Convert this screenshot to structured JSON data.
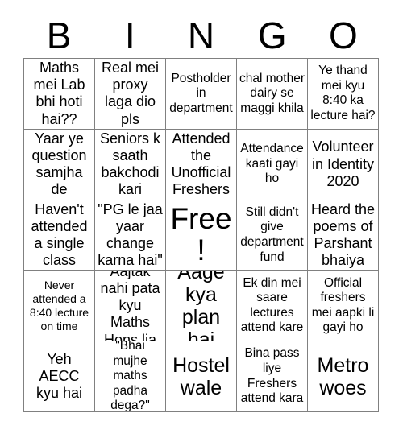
{
  "card": {
    "title_letters": [
      "B",
      "I",
      "N",
      "G",
      "O"
    ],
    "rows": [
      [
        {
          "text": "Maths mei Lab bhi hoti hai??",
          "size": "md"
        },
        {
          "text": "Real mei proxy laga dio pls",
          "size": "md"
        },
        {
          "text": "Postholder in department",
          "size": "sm"
        },
        {
          "text": "chal mother dairy se maggi khila",
          "size": "sm"
        },
        {
          "text": "Ye thand mei kyu 8:40 ka lecture hai?",
          "size": "sm"
        }
      ],
      [
        {
          "text": "Yaar ye question samjha de",
          "size": "md"
        },
        {
          "text": "Seniors k saath bakchodi kari",
          "size": "md"
        },
        {
          "text": "Attended the Unofficial Freshers",
          "size": "md"
        },
        {
          "text": "Attendance kaati gayi ho",
          "size": "sm"
        },
        {
          "text": "Volunteer in Identity 2020",
          "size": "md"
        }
      ],
      [
        {
          "text": "Haven't attended a single class",
          "size": "md"
        },
        {
          "text": "\"PG le jaa yaar change karna hai\"",
          "size": "md"
        },
        {
          "text": "Free!",
          "size": "xl"
        },
        {
          "text": "Still didn't give department fund",
          "size": "sm"
        },
        {
          "text": "Heard the poems of Parshant bhaiya",
          "size": "md"
        }
      ],
      [
        {
          "text": "Never attended a 8:40 lecture on time",
          "size": "xs"
        },
        {
          "text": "Aajtak nahi pata kyu Maths Hons lia",
          "size": "md"
        },
        {
          "text": "Aage kya plan hai",
          "size": "lg"
        },
        {
          "text": "Ek din mei saare lectures attend kare",
          "size": "sm"
        },
        {
          "text": "Official freshers mei aapki li gayi ho",
          "size": "sm"
        }
      ],
      [
        {
          "text": "Yeh AECC kyu hai",
          "size": "md"
        },
        {
          "text": "\"Bhai mujhe maths padha dega?\"",
          "size": "sm"
        },
        {
          "text": "Hostel wale",
          "size": "lg"
        },
        {
          "text": "Bina pass liye Freshers attend kara",
          "size": "sm"
        },
        {
          "text": "Metro woes",
          "size": "lg"
        }
      ]
    ]
  }
}
